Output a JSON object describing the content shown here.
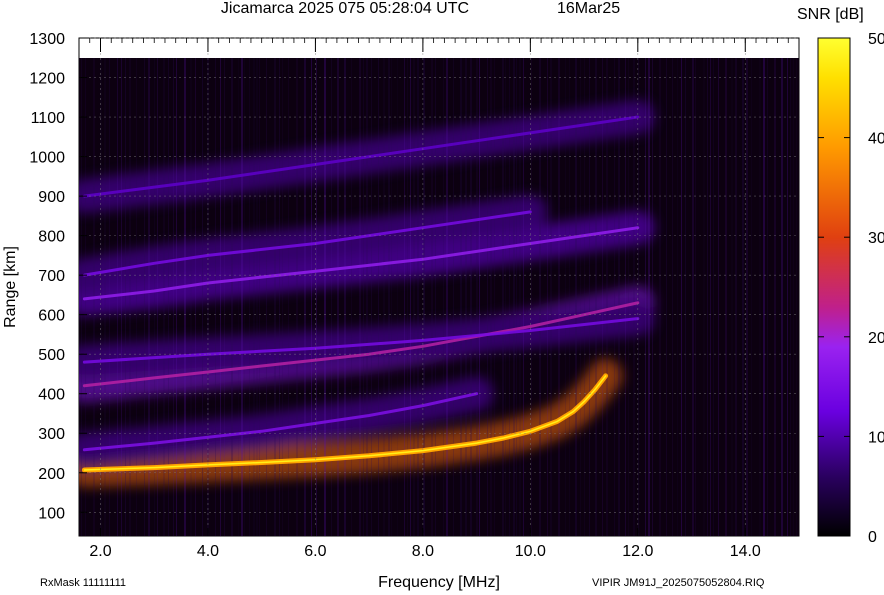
{
  "header": {
    "title": "Jicamarca 2025 075 05:28:04 UTC",
    "date": "16Mar25"
  },
  "footer": {
    "rxmask": "RxMask 11111111",
    "file": "VIPIR  JM91J_2025075052804.RIQ"
  },
  "chart_data": {
    "type": "heatmap",
    "title": "Jicamarca 2025 075 05:28:04 UTC",
    "xlabel": "Frequency [MHz]",
    "ylabel": "Range [km]",
    "xlim": [
      1.6,
      15.0
    ],
    "ylim": [
      40,
      1300
    ],
    "x_ticks": [
      "2.0",
      "4.0",
      "6.0",
      "8.0",
      "10.0",
      "12.0",
      "14.0"
    ],
    "y_ticks": [
      "100",
      "200",
      "300",
      "400",
      "500",
      "600",
      "700",
      "800",
      "900",
      "1000",
      "1100",
      "1200",
      "1300"
    ],
    "colorbar": {
      "label": "SNR [dB]",
      "range": [
        0,
        50
      ],
      "ticks": [
        "0",
        "10",
        "20",
        "30",
        "40",
        "50"
      ],
      "colors": [
        "#000000",
        "#3a0070",
        "#8a2be2",
        "#a11ae8",
        "#e03c14",
        "#ff8a00",
        "#ffe000",
        "#ffff40"
      ]
    },
    "traces": [
      {
        "name": "",
        "x": [
          1.7,
          3.0,
          4.0,
          5.0,
          6.0,
          7.0,
          8.0,
          9.0,
          9.5,
          10.0,
          10.5,
          10.8,
          11.0,
          11.2,
          11.4
        ],
        "y": [
          207,
          213,
          220,
          226,
          233,
          243,
          256,
          275,
          288,
          305,
          330,
          355,
          380,
          410,
          445
        ],
        "snr": 40
      },
      {
        "name": "",
        "x": [
          1.7,
          3.0,
          4.0,
          5.0,
          6.0,
          7.0,
          8.0,
          9.0
        ],
        "y": [
          258,
          275,
          290,
          305,
          325,
          345,
          370,
          400
        ],
        "snr": 15
      },
      {
        "name": "",
        "x": [
          1.7,
          3.0,
          4.0,
          5.0,
          6.0,
          7.0,
          8.0,
          9.0,
          10.0,
          11.0,
          12.0
        ],
        "y": [
          420,
          440,
          455,
          470,
          485,
          500,
          520,
          545,
          570,
          600,
          630
        ],
        "snr": 22
      },
      {
        "name": "",
        "x": [
          1.7,
          4.0,
          6.0,
          8.0,
          10.0,
          12.0
        ],
        "y": [
          480,
          500,
          515,
          535,
          560,
          590
        ],
        "snr": 14
      },
      {
        "name": "",
        "x": [
          1.7,
          3.0,
          4.0,
          6.0,
          8.0,
          10.0,
          12.0
        ],
        "y": [
          640,
          660,
          680,
          710,
          740,
          780,
          820
        ],
        "snr": 18
      },
      {
        "name": "",
        "x": [
          1.7,
          3.0,
          4.0,
          6.0,
          8.0,
          10.0
        ],
        "y": [
          700,
          730,
          750,
          780,
          820,
          860
        ],
        "snr": 14
      },
      {
        "name": "",
        "x": [
          1.7,
          4.0,
          6.0,
          8.0,
          10.0,
          12.0
        ],
        "y": [
          900,
          940,
          980,
          1020,
          1060,
          1100
        ],
        "snr": 11
      }
    ]
  }
}
